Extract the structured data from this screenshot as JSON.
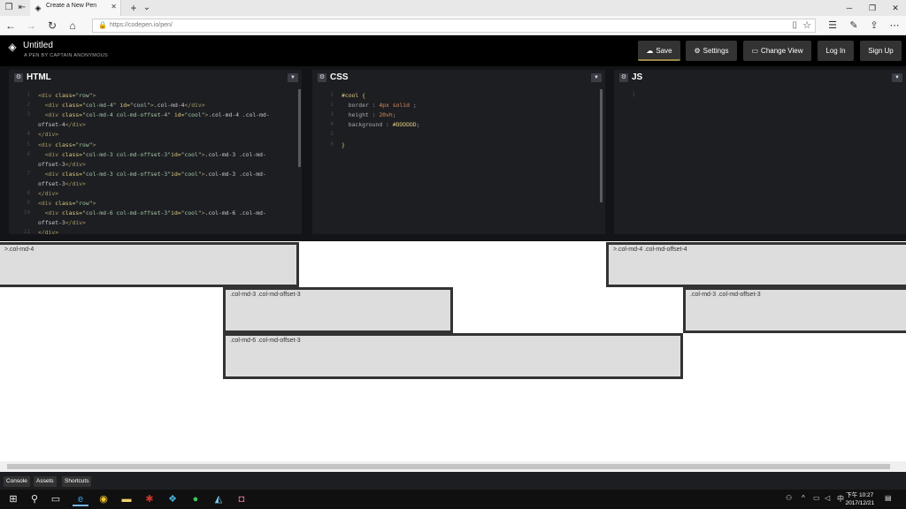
{
  "browser": {
    "tab_title": "Create a New Pen",
    "tab_close": "✕",
    "new_tab": "+",
    "tab_menu": "⌄",
    "url": "https://codepen.io/pen/",
    "win": {
      "min": "─",
      "max": "❐",
      "close": "✕"
    }
  },
  "header": {
    "title": "Untitled",
    "subtitle": "A PEN BY CAPTAIN ANONYMOUS",
    "buttons": {
      "save": "Save",
      "settings": "Settings",
      "change_view": "Change View",
      "login": "Log In",
      "signup": "Sign Up"
    }
  },
  "editors": {
    "html": {
      "name": "HTML"
    },
    "css": {
      "name": "CSS"
    },
    "js": {
      "name": "JS"
    }
  },
  "html_code": [
    {
      "n": "1",
      "parts": [
        [
          "tag",
          "<div "
        ],
        [
          "attr",
          "class="
        ],
        [
          "str",
          "\"row\""
        ],
        [
          "tag",
          ">"
        ]
      ]
    },
    {
      "n": "2",
      "parts": [
        [
          "txt",
          "  "
        ],
        [
          "tag",
          "<div "
        ],
        [
          "attr",
          "class="
        ],
        [
          "str",
          "\"col-md-4\""
        ],
        [
          "attr",
          " id="
        ],
        [
          "str",
          "\"cool\""
        ],
        [
          "tag",
          ">"
        ],
        [
          "txt",
          ".col-md-4"
        ],
        [
          "tag",
          "</div>"
        ]
      ]
    },
    {
      "n": "3",
      "parts": [
        [
          "txt",
          "  "
        ],
        [
          "tag",
          "<div "
        ],
        [
          "attr",
          "class="
        ],
        [
          "str",
          "\"col-md-4 col-md-offset-4\""
        ],
        [
          "attr",
          " id="
        ],
        [
          "str",
          "\"cool\""
        ],
        [
          "tag",
          ">"
        ],
        [
          "txt",
          ".col-md-4 .col-md-"
        ]
      ]
    },
    {
      "n": "",
      "parts": [
        [
          "txt",
          "offset-4"
        ],
        [
          "tag",
          "</div>"
        ]
      ]
    },
    {
      "n": "4",
      "parts": [
        [
          "tag",
          "</div>"
        ]
      ]
    },
    {
      "n": "5",
      "parts": [
        [
          "tag",
          "<div "
        ],
        [
          "attr",
          "class="
        ],
        [
          "str",
          "\"row\""
        ],
        [
          "tag",
          ">"
        ]
      ]
    },
    {
      "n": "6",
      "parts": [
        [
          "txt",
          "  "
        ],
        [
          "tag",
          "<div "
        ],
        [
          "attr",
          "class="
        ],
        [
          "str",
          "\"col-md-3 col-md-offset-3\""
        ],
        [
          "attr",
          "id="
        ],
        [
          "str",
          "\"cool\""
        ],
        [
          "tag",
          ">"
        ],
        [
          "txt",
          ".col-md-3 .col-md-"
        ]
      ]
    },
    {
      "n": "",
      "parts": [
        [
          "txt",
          "offset-3"
        ],
        [
          "tag",
          "</div>"
        ]
      ]
    },
    {
      "n": "7",
      "parts": [
        [
          "txt",
          "  "
        ],
        [
          "tag",
          "<div "
        ],
        [
          "attr",
          "class="
        ],
        [
          "str",
          "\"col-md-3 col-md-offset-3\""
        ],
        [
          "attr",
          "id="
        ],
        [
          "str",
          "\"cool\""
        ],
        [
          "tag",
          ">"
        ],
        [
          "txt",
          ".col-md-3 .col-md-"
        ]
      ]
    },
    {
      "n": "",
      "parts": [
        [
          "txt",
          "offset-3"
        ],
        [
          "tag",
          "</div>"
        ]
      ]
    },
    {
      "n": "8",
      "parts": [
        [
          "tag",
          "</div>"
        ]
      ]
    },
    {
      "n": "9",
      "parts": [
        [
          "tag",
          "<div "
        ],
        [
          "attr",
          "class="
        ],
        [
          "str",
          "\"row\""
        ],
        [
          "tag",
          ">"
        ]
      ]
    },
    {
      "n": "10",
      "parts": [
        [
          "txt",
          "  "
        ],
        [
          "tag",
          "<div "
        ],
        [
          "attr",
          "class="
        ],
        [
          "str",
          "\"col-md-6 col-md-offset-3\""
        ],
        [
          "attr",
          "id="
        ],
        [
          "str",
          "\"cool\""
        ],
        [
          "tag",
          ">"
        ],
        [
          "txt",
          ".col-md-6 .col-md-"
        ]
      ]
    },
    {
      "n": "",
      "parts": [
        [
          "txt",
          "offset-3"
        ],
        [
          "tag",
          "</div>"
        ]
      ]
    },
    {
      "n": "11",
      "parts": [
        [
          "tag",
          "</div>"
        ]
      ]
    }
  ],
  "css_code": [
    {
      "n": "1",
      "parts": [
        [
          "sel",
          "#cool {"
        ]
      ]
    },
    {
      "n": "2",
      "parts": [
        [
          "prop",
          "  border : "
        ],
        [
          "val",
          "4px solid"
        ],
        [
          "prop",
          " ;"
        ]
      ]
    },
    {
      "n": "3",
      "parts": [
        [
          "prop",
          "  height : "
        ],
        [
          "val",
          "20vh"
        ],
        [
          "prop",
          ";"
        ]
      ]
    },
    {
      "n": "4",
      "parts": [
        [
          "prop",
          "  background : "
        ],
        [
          "sel",
          "#DDDDDD"
        ],
        [
          "prop",
          ";"
        ]
      ]
    },
    {
      "n": "5",
      "parts": []
    },
    {
      "n": "6",
      "parts": [
        [
          "sel",
          "}"
        ]
      ]
    }
  ],
  "js_code": [
    {
      "n": "1",
      "parts": []
    }
  ],
  "preview": {
    "boxes": [
      {
        "name": "preview-box-col-md-4",
        "label": ">.col-md-4"
      },
      {
        "name": "preview-box-col-md-4-offset-4",
        "label": ">.col-md-4 .col-md-offset-4"
      },
      {
        "name": "preview-box-col-md-3-offset-3-a",
        "label": ".col-md-3 .col-md-offset-3"
      },
      {
        "name": "preview-box-col-md-3-offset-3-b",
        "label": ".col-md-3 .col-md-offset-3"
      },
      {
        "name": "preview-box-col-md-6-offset-3",
        "label": ".col-md-6 .col-md-offset-3"
      }
    ]
  },
  "footer": {
    "console": "Console",
    "assets": "Assets",
    "shortcuts": "Shortcuts"
  },
  "taskbar": {
    "time": "下午 10:27",
    "date": "2017/12/21"
  }
}
